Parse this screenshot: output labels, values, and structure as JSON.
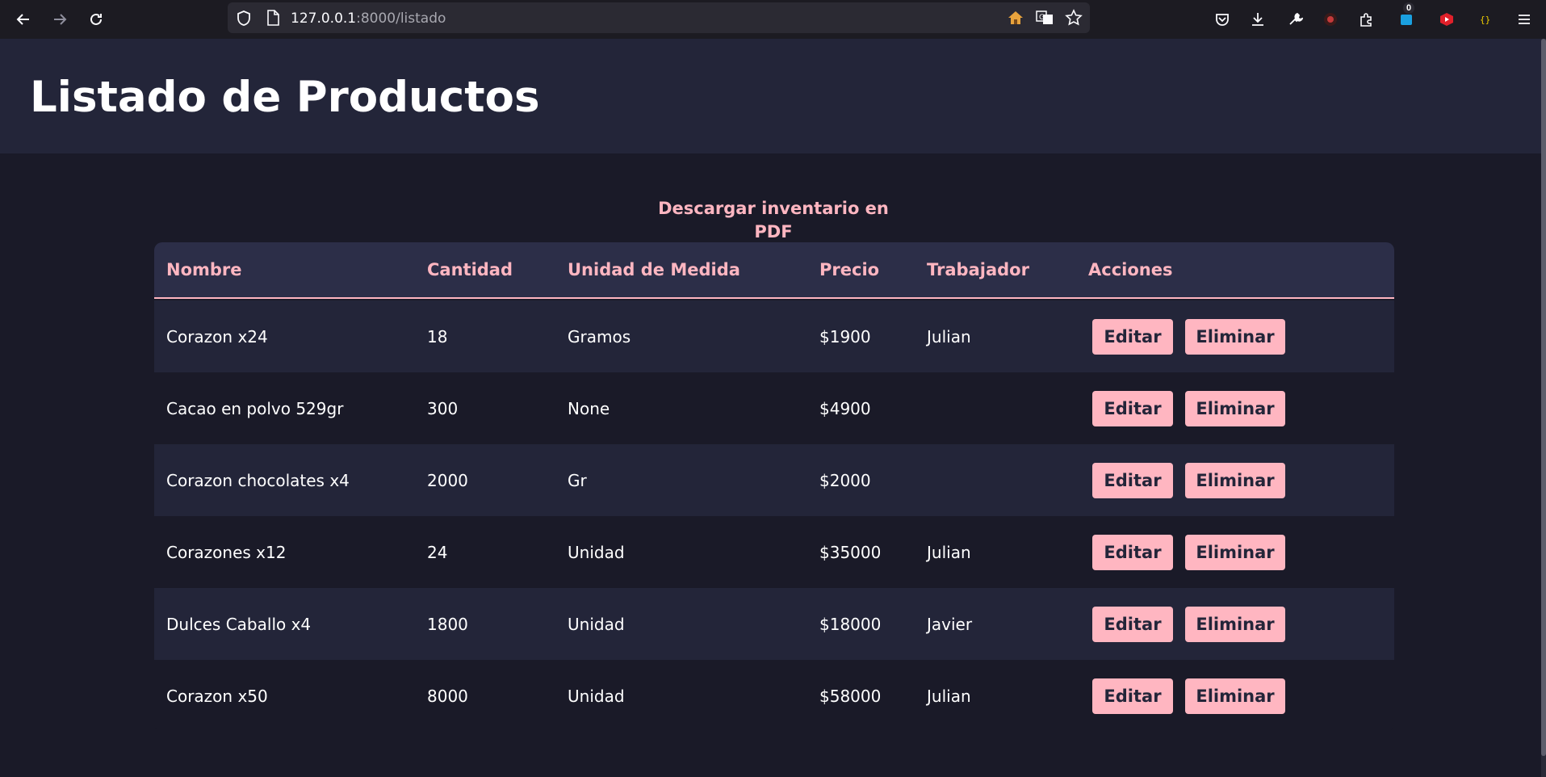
{
  "browser": {
    "url_host": "127.0.0.1",
    "url_path": ":8000/listado",
    "extension_badge": "0"
  },
  "page": {
    "title": "Listado de Productos",
    "pdf_link": "Descargar inventario en PDF"
  },
  "table": {
    "headers": [
      "Nombre",
      "Cantidad",
      "Unidad de Medida",
      "Precio",
      "Trabajador",
      "Acciones"
    ],
    "rows": [
      {
        "nombre": "Corazon x24",
        "cantidad": "18",
        "unidad": "Gramos",
        "precio": "$1900",
        "trabajador": "Julian"
      },
      {
        "nombre": "Cacao en polvo 529gr",
        "cantidad": "300",
        "unidad": "None",
        "precio": "$4900",
        "trabajador": ""
      },
      {
        "nombre": "Corazon chocolates x4",
        "cantidad": "2000",
        "unidad": "Gr",
        "precio": "$2000",
        "trabajador": ""
      },
      {
        "nombre": "Corazones x12",
        "cantidad": "24",
        "unidad": "Unidad",
        "precio": "$35000",
        "trabajador": "Julian"
      },
      {
        "nombre": "Dulces Caballo x4",
        "cantidad": "1800",
        "unidad": "Unidad",
        "precio": "$18000",
        "trabajador": "Javier"
      },
      {
        "nombre": "Corazon x50",
        "cantidad": "8000",
        "unidad": "Unidad",
        "precio": "$58000",
        "trabajador": "Julian"
      }
    ],
    "edit_label": "Editar",
    "delete_label": "Eliminar"
  },
  "colors": {
    "accent": "#ffb6c1",
    "header_bg": "#232539",
    "page_bg": "#1a1a28",
    "table_head_bg": "#2c2e48"
  },
  "icons": {
    "toolbar": [
      "back-icon",
      "forward-icon",
      "reload-icon",
      "shield-icon",
      "page-icon",
      "home-icon",
      "translate-icon",
      "star-icon",
      "pocket-icon",
      "download-icon",
      "wrench-icon",
      "extension-icon",
      "puzzle-icon",
      "extension-badge-icon",
      "youtube-icon",
      "json-icon",
      "menu-icon"
    ]
  }
}
